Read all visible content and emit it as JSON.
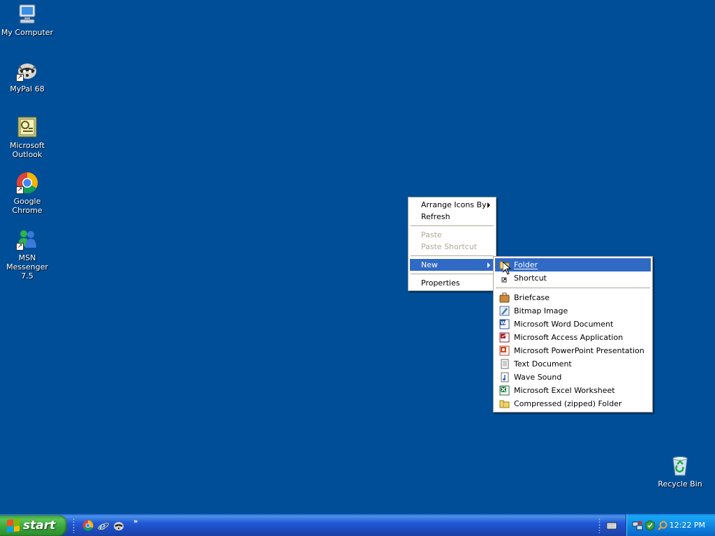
{
  "desktop": {
    "icons": [
      {
        "label": "My Computer",
        "icon": "my-computer-icon"
      },
      {
        "label": "MyPal 68",
        "icon": "mypal-icon"
      },
      {
        "label": "Microsoft\nOutlook",
        "icon": "outlook-icon"
      },
      {
        "label": "Google Chrome",
        "icon": "chrome-icon"
      },
      {
        "label": "MSN\nMessenger 7.5",
        "icon": "msn-messenger-icon"
      },
      {
        "label": "Recycle Bin",
        "icon": "recycle-bin-icon"
      }
    ]
  },
  "context_menu": {
    "items": [
      {
        "label": "Arrange Icons By",
        "submenu": true
      },
      {
        "label": "Refresh"
      },
      {
        "label": "Paste",
        "disabled": true
      },
      {
        "label": "Paste Shortcut",
        "disabled": true
      },
      {
        "label": "New",
        "submenu": true,
        "selected": true
      },
      {
        "label": "Properties"
      }
    ]
  },
  "new_submenu": {
    "items": [
      {
        "label": "Folder",
        "icon": "folder-icon",
        "selected": true
      },
      {
        "label": "Shortcut",
        "icon": "shortcut-icon"
      },
      {
        "label": "Briefcase",
        "icon": "briefcase-icon"
      },
      {
        "label": "Bitmap Image",
        "icon": "bitmap-icon"
      },
      {
        "label": "Microsoft Word Document",
        "icon": "word-icon"
      },
      {
        "label": "Microsoft Access Application",
        "icon": "access-icon"
      },
      {
        "label": "Microsoft PowerPoint Presentation",
        "icon": "powerpoint-icon"
      },
      {
        "label": "Text Document",
        "icon": "text-document-icon"
      },
      {
        "label": "Wave Sound",
        "icon": "wave-sound-icon"
      },
      {
        "label": "Microsoft Excel Worksheet",
        "icon": "excel-icon"
      },
      {
        "label": "Compressed (zipped) Folder",
        "icon": "zip-folder-icon"
      }
    ]
  },
  "taskbar": {
    "start_label": "start",
    "quick_launch": [
      "chrome-icon",
      "internet-explorer-icon",
      "mypal-icon"
    ],
    "tray_icons": [
      "keyboard-icon",
      "network-icon",
      "security-icon",
      "search-icon"
    ],
    "clock": "12:22 PM"
  },
  "colors": {
    "desktop_bg": "#004e98",
    "menu_highlight": "#316ac5",
    "start_green": "#38a538",
    "taskbar_blue": "#2157d7"
  }
}
